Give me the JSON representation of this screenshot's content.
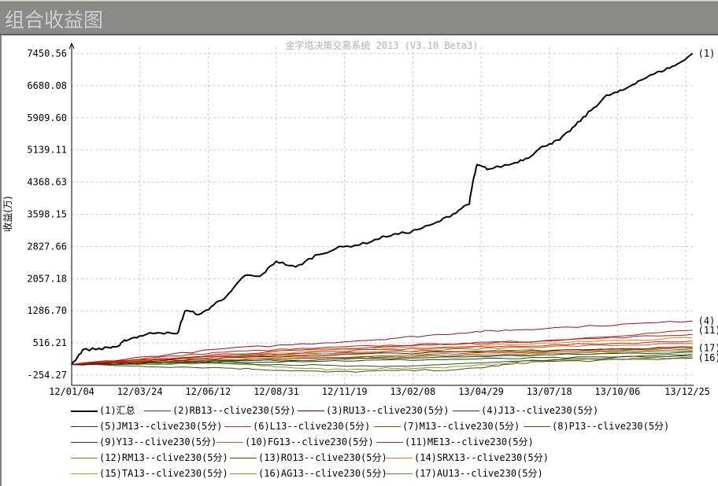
{
  "window": {
    "title": "组合收益图"
  },
  "chart_data": {
    "type": "line",
    "title": "金字塔决策交易系统 2013 (V3.10 Beta3)",
    "ylabel": "收益(万)",
    "ylim": [
      -254.27,
      7450.56
    ],
    "yticks": [
      "7450.56",
      "6680.08",
      "5909.60",
      "5139.11",
      "4368.63",
      "3598.15",
      "2827.66",
      "2057.18",
      "1286.70",
      "516.21",
      "-254.27"
    ],
    "ytick_values": [
      7450.56,
      6680.08,
      5909.6,
      5139.11,
      4368.63,
      3598.15,
      2827.66,
      2057.18,
      1286.7,
      516.21,
      -254.27
    ],
    "xticks": [
      "12/01/04",
      "12/03/24",
      "12/06/12",
      "12/08/31",
      "12/11/19",
      "13/02/08",
      "13/04/29",
      "13/07/18",
      "13/10/06",
      "13/12/25"
    ],
    "xlim_days": [
      0,
      721
    ],
    "grid": true,
    "series": [
      {
        "name": "(1)汇总",
        "end_label": "(1)",
        "color": "#000000",
        "x": [
          0,
          13,
          36,
          55,
          64,
          83,
          101,
          124,
          133,
          152,
          170,
          184,
          203,
          221,
          240,
          263,
          286,
          314,
          342,
          370,
          397,
          425,
          448,
          467,
          471,
          476,
          490,
          518,
          536,
          555,
          573,
          591,
          610,
          628,
          647,
          665,
          693,
          711,
          729
        ],
        "y": [
          0,
          350,
          385,
          440,
          590,
          700,
          780,
          720,
          1290,
          1200,
          1480,
          1665,
          2137,
          2100,
          2477,
          2325,
          2610,
          2800,
          2890,
          3080,
          3175,
          3360,
          3607,
          3870,
          4360,
          4775,
          4680,
          4813,
          4963,
          5245,
          5378,
          5717,
          6094,
          6433,
          6565,
          6790,
          7036,
          7186,
          7450
        ]
      },
      {
        "name": "(2)RB13--clive230(5分)",
        "color": "#b01818",
        "x": [
          0,
          180,
          360,
          540,
          729
        ],
        "y": [
          0,
          250,
          420,
          560,
          720
        ]
      },
      {
        "name": "(3)RU13--clive230(5分)",
        "color": "#800000",
        "x": [
          0,
          180,
          360,
          540,
          729
        ],
        "y": [
          0,
          150,
          260,
          330,
          420
        ]
      },
      {
        "name": "(4)J13--clive230(5分)",
        "end_label": "(4)",
        "color": "#a01010",
        "x": [
          0,
          180,
          360,
          470,
          540,
          729
        ],
        "y": [
          0,
          380,
          600,
          780,
          850,
          1044
        ]
      },
      {
        "name": "(5)JM13--clive230(5分)",
        "color": "#1a4010",
        "x": [
          0,
          180,
          360,
          540,
          729
        ],
        "y": [
          0,
          60,
          100,
          150,
          200
        ]
      },
      {
        "name": "(6)L13--clive230(5分)",
        "color": "#c83010",
        "x": [
          0,
          180,
          360,
          540,
          729
        ],
        "y": [
          0,
          200,
          350,
          450,
          560
        ]
      },
      {
        "name": "(7)M13--clive230(5分)",
        "color": "#b04000",
        "x": [
          0,
          180,
          360,
          540,
          729
        ],
        "y": [
          0,
          120,
          200,
          300,
          380
        ]
      },
      {
        "name": "(8)P13--clive230(5分)",
        "color": "#604010",
        "x": [
          0,
          180,
          300,
          460,
          540,
          729
        ],
        "y": [
          0,
          -80,
          -180,
          -120,
          60,
          150
        ]
      },
      {
        "name": "(9)Y13--clive230(5分)",
        "color": "#204010",
        "x": [
          0,
          180,
          360,
          540,
          729
        ],
        "y": [
          0,
          80,
          140,
          220,
          300
        ]
      },
      {
        "name": "(10)FG13--clive230(5分)",
        "color": "#e05010",
        "x": [
          0,
          180,
          360,
          540,
          729
        ],
        "y": [
          0,
          180,
          300,
          420,
          500
        ]
      },
      {
        "name": "(11)ME13--clive230(5分)",
        "end_label": "(11)",
        "color": "#c02010",
        "x": [
          0,
          180,
          360,
          540,
          729
        ],
        "y": [
          0,
          300,
          450,
          550,
          820
        ]
      },
      {
        "name": "(12)RM13--clive230(5分)",
        "color": "#a07020",
        "x": [
          0,
          180,
          360,
          540,
          729
        ],
        "y": [
          0,
          100,
          180,
          260,
          340
        ]
      },
      {
        "name": "(13)RO13--clive230(5分)",
        "color": "#305010",
        "x": [
          0,
          180,
          360,
          540,
          729
        ],
        "y": [
          0,
          40,
          -60,
          80,
          250
        ]
      },
      {
        "name": "(14)SRX13--clive230(5分)",
        "color": "#e08020",
        "x": [
          0,
          180,
          360,
          540,
          729
        ],
        "y": [
          0,
          220,
          380,
          500,
          640
        ]
      },
      {
        "name": "(15)TA13--clive230(5分)",
        "color": "#c0a020",
        "x": [
          0,
          180,
          360,
          540,
          729
        ],
        "y": [
          0,
          90,
          170,
          240,
          320
        ]
      },
      {
        "name": "(16)AG13--clive230(5分)",
        "end_label": "(16)",
        "color": "#80a020",
        "x": [
          0,
          180,
          300,
          460,
          540,
          729
        ],
        "y": [
          0,
          20,
          -120,
          -60,
          100,
          160
        ]
      },
      {
        "name": "(17)AU13--clive230(5分)",
        "end_label": "(17)",
        "color": "#40a020",
        "x": [
          0,
          180,
          360,
          540,
          729
        ],
        "y": [
          0,
          200,
          300,
          340,
          400
        ]
      }
    ]
  }
}
